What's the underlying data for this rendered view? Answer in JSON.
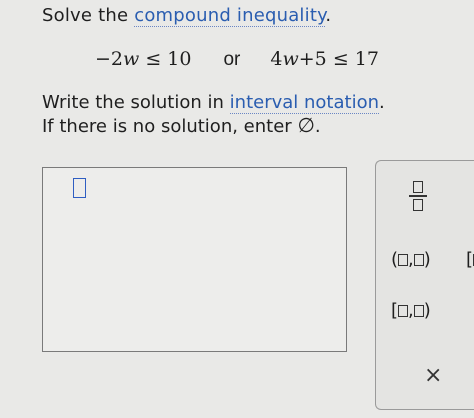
{
  "prompt": {
    "lead": "Solve the",
    "link": "compound inequality",
    "after": "."
  },
  "inequalities": {
    "left": {
      "op_neg": "−",
      "coef": "2",
      "var": "w",
      "rel": "≤",
      "rhs": "10"
    },
    "connector": "or",
    "right": {
      "coef": "4",
      "var": "w",
      "plus": "+",
      "addend": "5",
      "rel": "≤",
      "rhs": "17"
    }
  },
  "instructions": {
    "line1_lead": "Write the solution in",
    "line1_link": "interval notation",
    "line1_after": ".",
    "line2_lead": "If there is no solution, enter",
    "empty_set_symbol": "∅",
    "line2_after": "."
  },
  "palette": {
    "open_open": {
      "open": "(",
      "comma": ",",
      "close": ")"
    },
    "closed_open": {
      "open": "[",
      "comma": ",",
      "close": ")"
    },
    "half_cut": {
      "open": "["
    },
    "clear_symbol": "×"
  }
}
